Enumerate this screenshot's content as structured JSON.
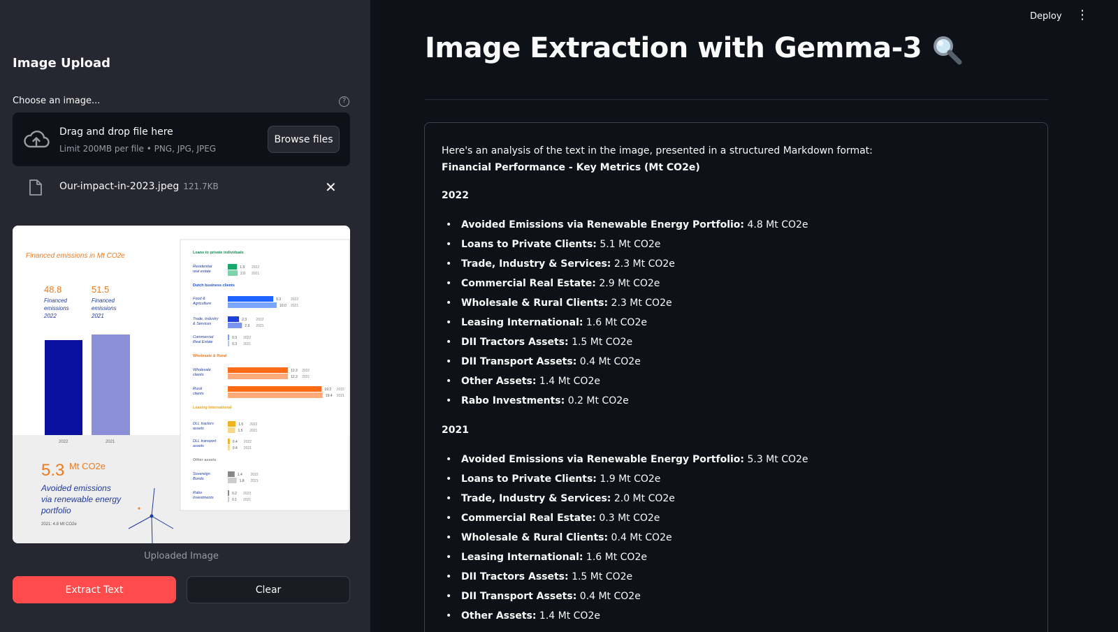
{
  "sidebar": {
    "title": "Image Upload",
    "choose_label": "Choose an image...",
    "help_icon": "question-circle-icon",
    "dropzone": {
      "main_text": "Drag and drop file here",
      "sub_text": "Limit 200MB per file • PNG, JPG, JPEG",
      "browse_label": "Browse files",
      "icon": "cloud-upload-icon"
    },
    "file": {
      "name": "Our-impact-in-2023.jpeg",
      "size": "121.7KB",
      "close_glyph": "✕"
    },
    "image_caption": "Uploaded Image",
    "extract_label": "Extract Text",
    "clear_label": "Clear"
  },
  "uploaded_image": {
    "heading": "Financed emissions in Mt CO2e",
    "stat_2022": "48.8",
    "stat_2022_label_1": "Financed",
    "stat_2022_label_2": "emissions",
    "stat_2022_label_3": "2022",
    "stat_2021": "51.5",
    "stat_2021_label_1": "Financed",
    "stat_2021_label_2": "emissions",
    "stat_2021_label_3": "2021",
    "bar_2022_label": "2022",
    "bar_2021_label": "2021",
    "avoided_value": "5.3",
    "avoided_unit": "Mt CO2e",
    "avoided_line_1": "Avoided emissions",
    "avoided_line_2": "via renewable energy",
    "avoided_line_3": "portfolio",
    "avoided_2021": "2021: 4.8 Mt CO2e",
    "right_panel": {
      "sec_private": "Loans to private individuals",
      "sec_dutch": "Dutch business clients",
      "sec_wholesale": "Wholesale & Rural",
      "sec_leasing": "Leasing International",
      "sec_other": "Other assets",
      "rows": [
        {
          "l1": "Residential",
          "l2": "real estate",
          "v1": "1.9",
          "v2": "2.0"
        },
        {
          "l1": "Food &",
          "l2": "Agriculture",
          "v1": "9.3",
          "v2": "10.0"
        },
        {
          "l1": "Trade, Industry",
          "l2": "& Services",
          "v1": "2.3",
          "v2": "2.9"
        },
        {
          "l1": "Commercial",
          "l2": "Real Estate",
          "v1": "0.3",
          "v2": "0.3"
        },
        {
          "l1": "Wholesale",
          "l2": "clients",
          "v1": "12.3",
          "v2": "12.3"
        },
        {
          "l1": "Rural",
          "l2": "clients",
          "v1": "19.2",
          "v2": "19.4"
        },
        {
          "l1": "DLL tractors",
          "l2": "assets",
          "v1": "1.6",
          "v2": "1.5"
        },
        {
          "l1": "DLL transport",
          "l2": "assets",
          "v1": "0.4",
          "v2": "0.4"
        },
        {
          "l1": "Sovereign",
          "l2": "Bonds",
          "v1": "1.4",
          "v2": "1.8"
        },
        {
          "l1": "Rabo",
          "l2": "Investments",
          "v1": "0.2",
          "v2": "0.1"
        }
      ],
      "y2022": "2022",
      "y2021": "2021"
    }
  },
  "header": {
    "deploy_label": "Deploy",
    "menu_icon": "kebab-menu-icon"
  },
  "main": {
    "title": "Image Extraction with Gemma-3",
    "title_icon": "magnifying-glass-icon",
    "result": {
      "intro": "Here's an analysis of the text in the image, presented in a structured Markdown format:",
      "heading": "Financial Performance - Key Metrics (Mt CO2e)",
      "sections": [
        {
          "year": "2022",
          "items": [
            {
              "label": "Avoided Emissions via Renewable Energy Portfolio:",
              "value": " 4.8 Mt CO2e"
            },
            {
              "label": "Loans to Private Clients:",
              "value": " 5.1 Mt CO2e"
            },
            {
              "label": "Trade, Industry & Services:",
              "value": " 2.3 Mt CO2e"
            },
            {
              "label": "Commercial Real Estate:",
              "value": " 2.9 Mt CO2e"
            },
            {
              "label": "Wholesale & Rural Clients:",
              "value": " 2.3 Mt CO2e"
            },
            {
              "label": "Leasing International:",
              "value": " 1.6 Mt CO2e"
            },
            {
              "label": "DII Tractors Assets:",
              "value": " 1.5 Mt CO2e"
            },
            {
              "label": "DII Transport Assets:",
              "value": " 0.4 Mt CO2e"
            },
            {
              "label": "Other Assets:",
              "value": " 1.4 Mt CO2e"
            },
            {
              "label": "Rabo Investments:",
              "value": " 0.2 Mt CO2e"
            }
          ]
        },
        {
          "year": "2021",
          "items": [
            {
              "label": "Avoided Emissions via Renewable Energy Portfolio:",
              "value": " 5.3 Mt CO2e"
            },
            {
              "label": "Loans to Private Clients:",
              "value": " 1.9 Mt CO2e"
            },
            {
              "label": "Trade, Industry & Services:",
              "value": " 2.0 Mt CO2e"
            },
            {
              "label": "Commercial Real Estate:",
              "value": " 0.3 Mt CO2e"
            },
            {
              "label": "Wholesale & Rural Clients:",
              "value": " 0.4 Mt CO2e"
            },
            {
              "label": "Leasing International:",
              "value": " 1.6 Mt CO2e"
            },
            {
              "label": "DII Tractors Assets:",
              "value": " 1.5 Mt CO2e"
            },
            {
              "label": "DII Transport Assets:",
              "value": " 0.4 Mt CO2e"
            },
            {
              "label": "Other Assets:",
              "value": " 1.4 Mt CO2e"
            }
          ]
        }
      ]
    }
  },
  "colors": {
    "sidebar_bg": "#262730",
    "main_bg": "#0e1117",
    "primary": "#ff4b4b",
    "text": "#fafafa",
    "muted": "#9a9ca4"
  }
}
